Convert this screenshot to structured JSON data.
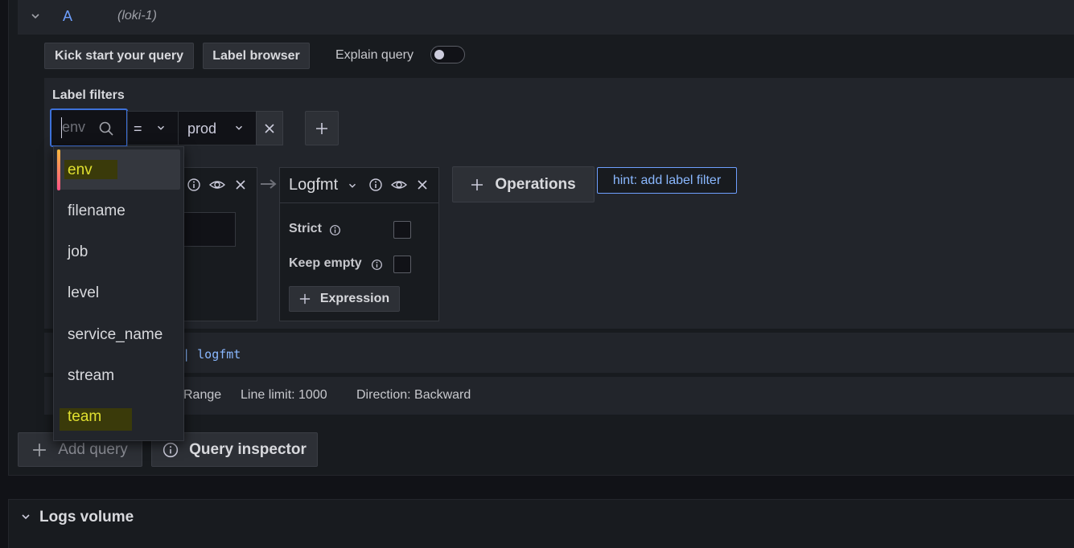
{
  "query": {
    "letter": "A",
    "datasource": "(loki-1)"
  },
  "toolbar": {
    "kick_start": "Kick start your query",
    "label_browser": "Label browser",
    "explain_query": "Explain query"
  },
  "label_filters": {
    "title": "Label filters",
    "label_placeholder": "env",
    "operator": "=",
    "value": "prod"
  },
  "operation": {
    "title": "Logfmt",
    "strict_label": "Strict",
    "keep_empty_label": "Keep empty",
    "expression_label": "Expression"
  },
  "operations_button": "Operations",
  "hint": "hint: add label filter",
  "query_preview": "`` | logfmt",
  "options": {
    "range": "Range",
    "line_limit": "Line limit: 1000",
    "direction": "Direction: Backward"
  },
  "footer": {
    "add_query": "Add query",
    "query_inspector": "Query inspector"
  },
  "logs_volume": "Logs volume",
  "dropdown": {
    "items": [
      "env",
      "filename",
      "job",
      "level",
      "service_name",
      "stream",
      "team"
    ]
  },
  "colors": {
    "accent": "#6e9fff",
    "highlight": "#e0e030"
  }
}
